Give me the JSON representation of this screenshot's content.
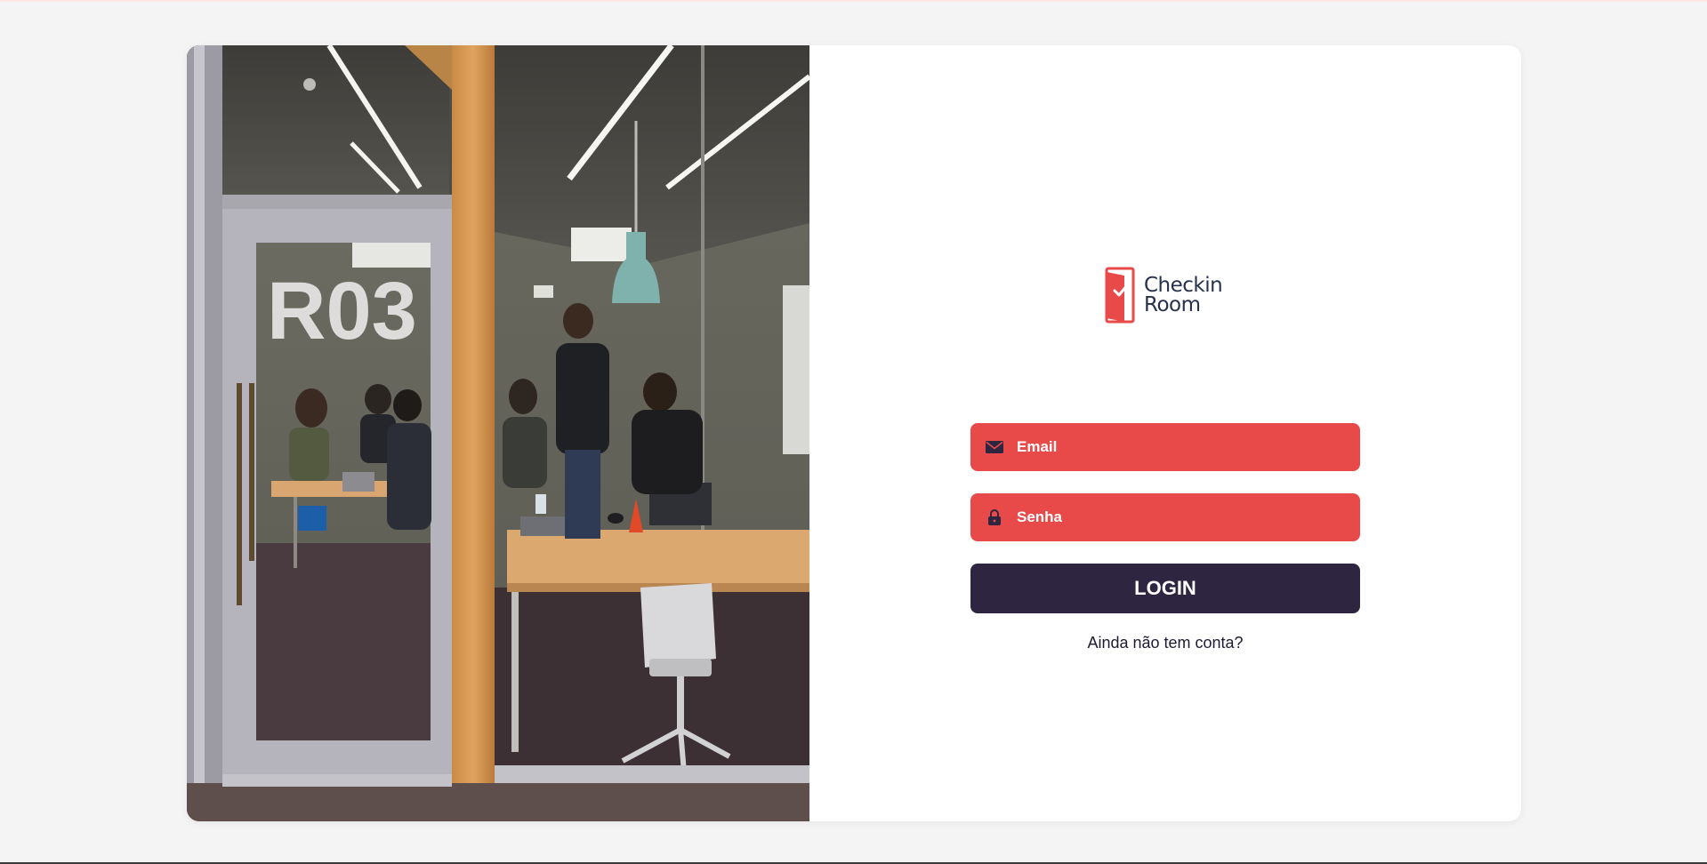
{
  "photo": {
    "alt": "Meeting room R03 with people working",
    "room_sign": "R03"
  },
  "logo": {
    "line1": "Checkin",
    "line2": "Room",
    "icon": "door-check-icon"
  },
  "form": {
    "email": {
      "placeholder": "Email",
      "value": "",
      "icon": "envelope-icon"
    },
    "password": {
      "placeholder": "Senha",
      "value": "",
      "icon": "lock-icon"
    },
    "login_label": "LOGIN",
    "signup_link": "Ainda não tem conta?"
  },
  "colors": {
    "page_background": "#f4f4f4",
    "card_background": "#ffffff",
    "field_red": "#e84a4a",
    "button_dark": "#2e2540",
    "logo_navy": "#26324d"
  }
}
